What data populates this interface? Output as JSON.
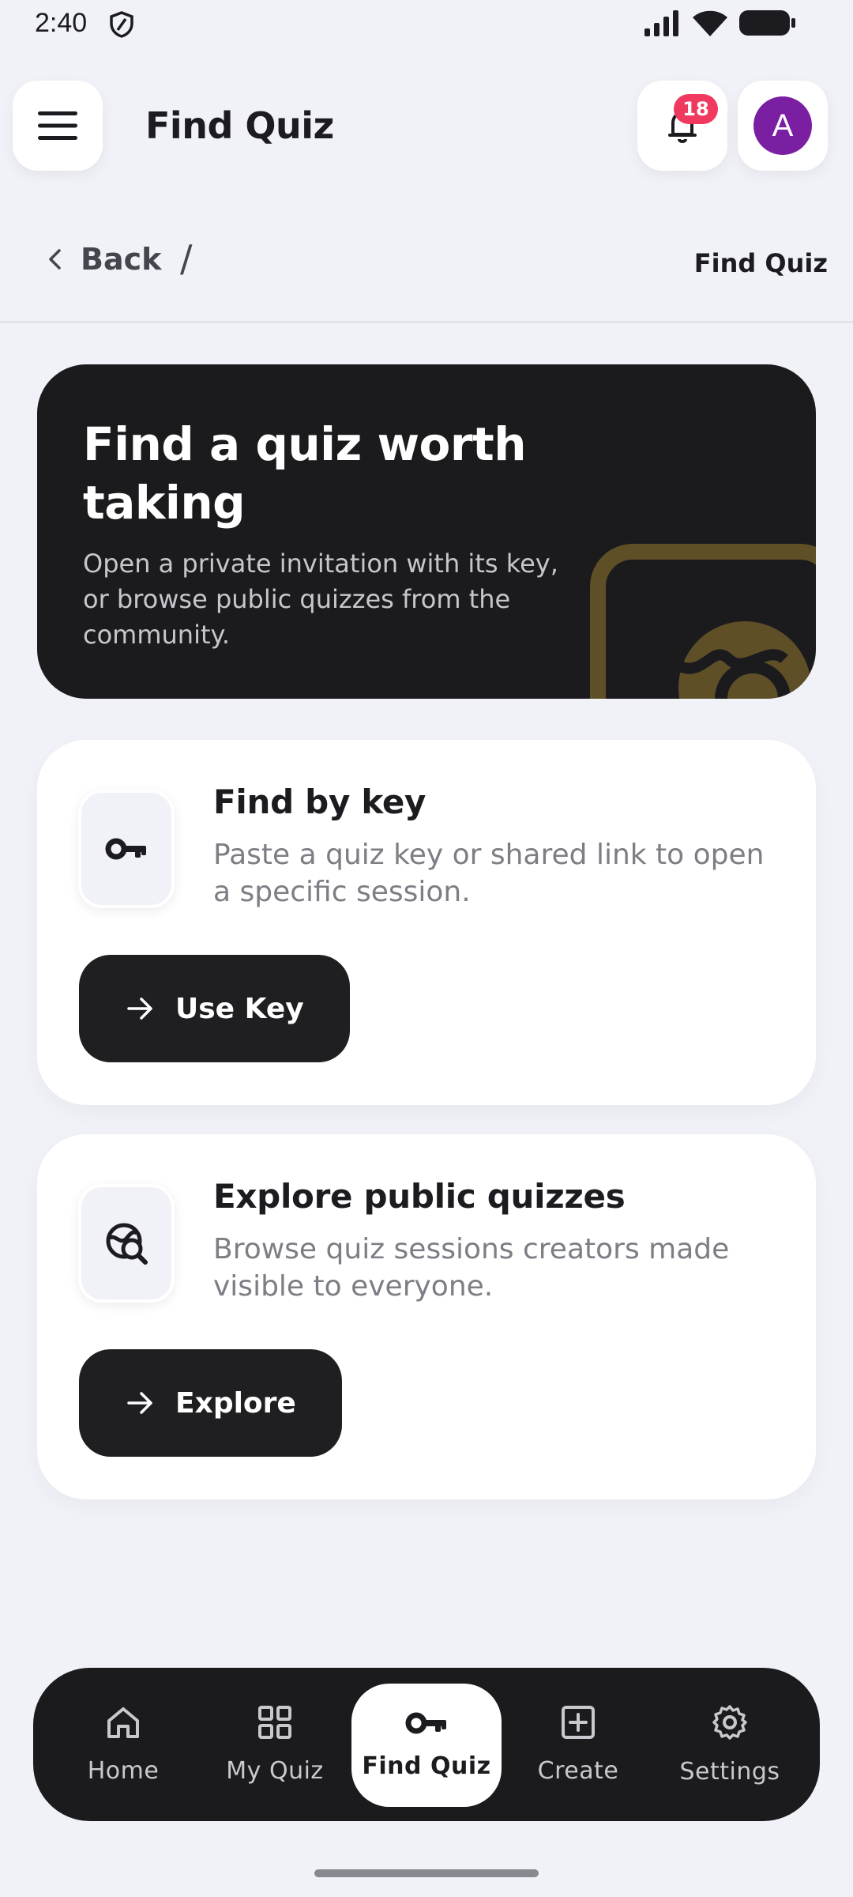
{
  "status_bar": {
    "time": "2:40"
  },
  "header": {
    "title": "Find Quiz",
    "notification_count": "18",
    "avatar_initial": "A",
    "avatar_color": "#7b1fa2"
  },
  "breadcrumb": {
    "back_label": "Back",
    "separator": "/",
    "current": "Find Quiz"
  },
  "hero": {
    "title": "Find a quiz worth taking",
    "description": "Open a private invitation with its key, or browse public quizzes from the community."
  },
  "cards": [
    {
      "icon": "key-icon",
      "title": "Find by key",
      "description": "Paste a quiz key or shared link to open a specific session.",
      "button_label": "Use Key"
    },
    {
      "icon": "globe-search-icon",
      "title": "Explore public quizzes",
      "description": "Browse quiz sessions creators made visible to everyone.",
      "button_label": "Explore"
    }
  ],
  "bottom_nav": {
    "items": [
      {
        "label": "Home",
        "icon": "home-icon",
        "active": false
      },
      {
        "label": "My Quiz",
        "icon": "grid-icon",
        "active": false
      },
      {
        "label": "Find Quiz",
        "icon": "key-icon",
        "active": true
      },
      {
        "label": "Create",
        "icon": "plus-square-icon",
        "active": false
      },
      {
        "label": "Settings",
        "icon": "gear-icon",
        "active": false
      }
    ]
  },
  "colors": {
    "background": "#f1f2f7",
    "dark_surface": "#1b1b1e",
    "badge": "#f0395f",
    "accent_gold": "#6b5a2a"
  }
}
